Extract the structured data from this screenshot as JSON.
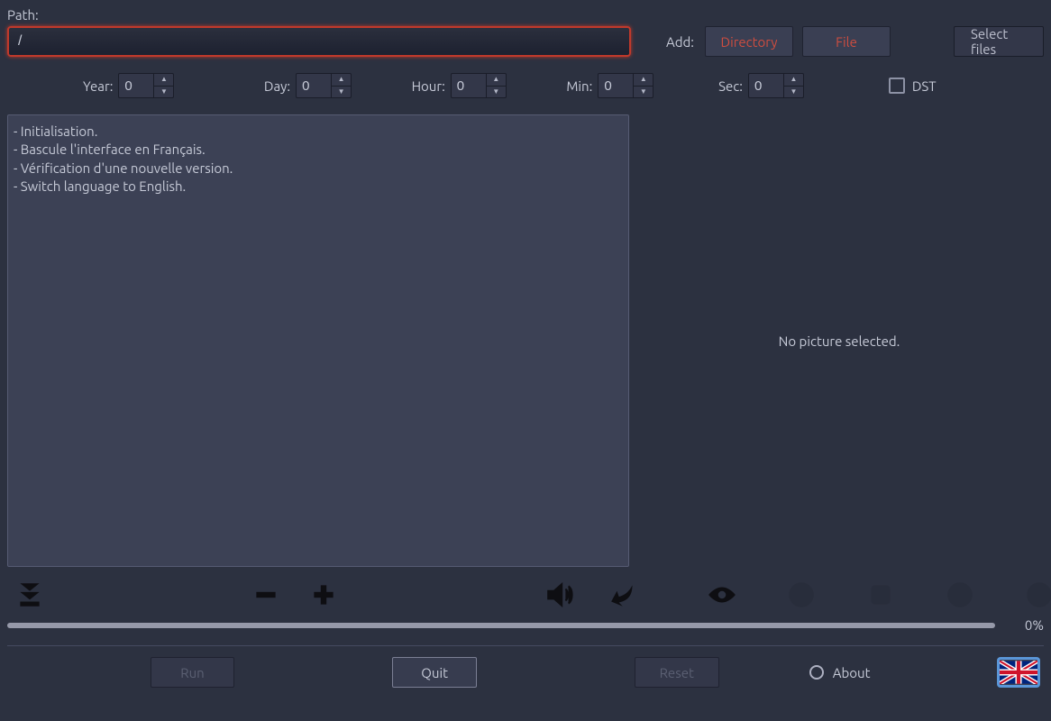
{
  "path": {
    "label": "Path:",
    "value": "/"
  },
  "add": {
    "label": "Add:",
    "directory": "Directory",
    "file": "File",
    "select_files": "Select files"
  },
  "time": {
    "year": {
      "label": "Year:",
      "value": "0"
    },
    "day": {
      "label": "Day:",
      "value": "0"
    },
    "hour": {
      "label": "Hour:",
      "value": "0"
    },
    "min": {
      "label": "Min:",
      "value": "0"
    },
    "sec": {
      "label": "Sec:",
      "value": "0"
    },
    "dst": {
      "label": "DST",
      "checked": false
    }
  },
  "log": "- Initialisation.\n- Bascule l'interface en Français.\n- Vérification d'une nouvelle version.\n- Switch language to English.",
  "preview": {
    "empty_text": "No picture selected."
  },
  "progress": {
    "percent": "0%"
  },
  "bottom": {
    "run": "Run",
    "quit": "Quit",
    "reset": "Reset",
    "about": "About"
  },
  "language_flag": "en-GB"
}
